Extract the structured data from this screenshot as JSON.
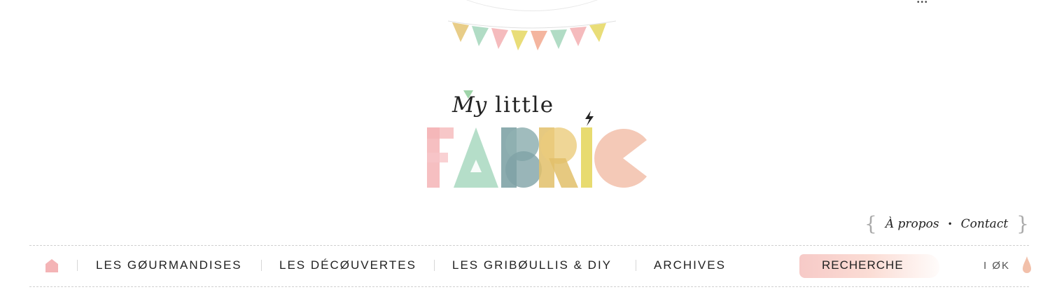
{
  "header": {
    "corner_glyph": "•••",
    "logo": {
      "my": "My",
      "little": "little",
      "wordmark": "FABRIC"
    }
  },
  "top_links": {
    "open_brace": "{",
    "about": "À propos",
    "separator": "•",
    "contact": "Contact",
    "close_brace": "}"
  },
  "nav": {
    "items": [
      {
        "label": "LES GØURMANDISES"
      },
      {
        "label": "LES DÉCØUVERTES"
      },
      {
        "label": "LES GRIBØULLIS & DIY"
      },
      {
        "label": "ARCHIVES"
      }
    ],
    "search_label": "RECHERCHE",
    "ok_label": "I ØK"
  },
  "colors": {
    "pink": "#f4b4b6",
    "mint": "#a8d8bf",
    "teal": "#7fa3a6",
    "mustard": "#e2c06a",
    "yellow": "#e5d760",
    "peach": "#f2c0aa",
    "bunting_green": "#9fd4a9"
  },
  "icons": [
    "home-icon",
    "bolt-icon",
    "drop-icon",
    "bunting-flags"
  ]
}
